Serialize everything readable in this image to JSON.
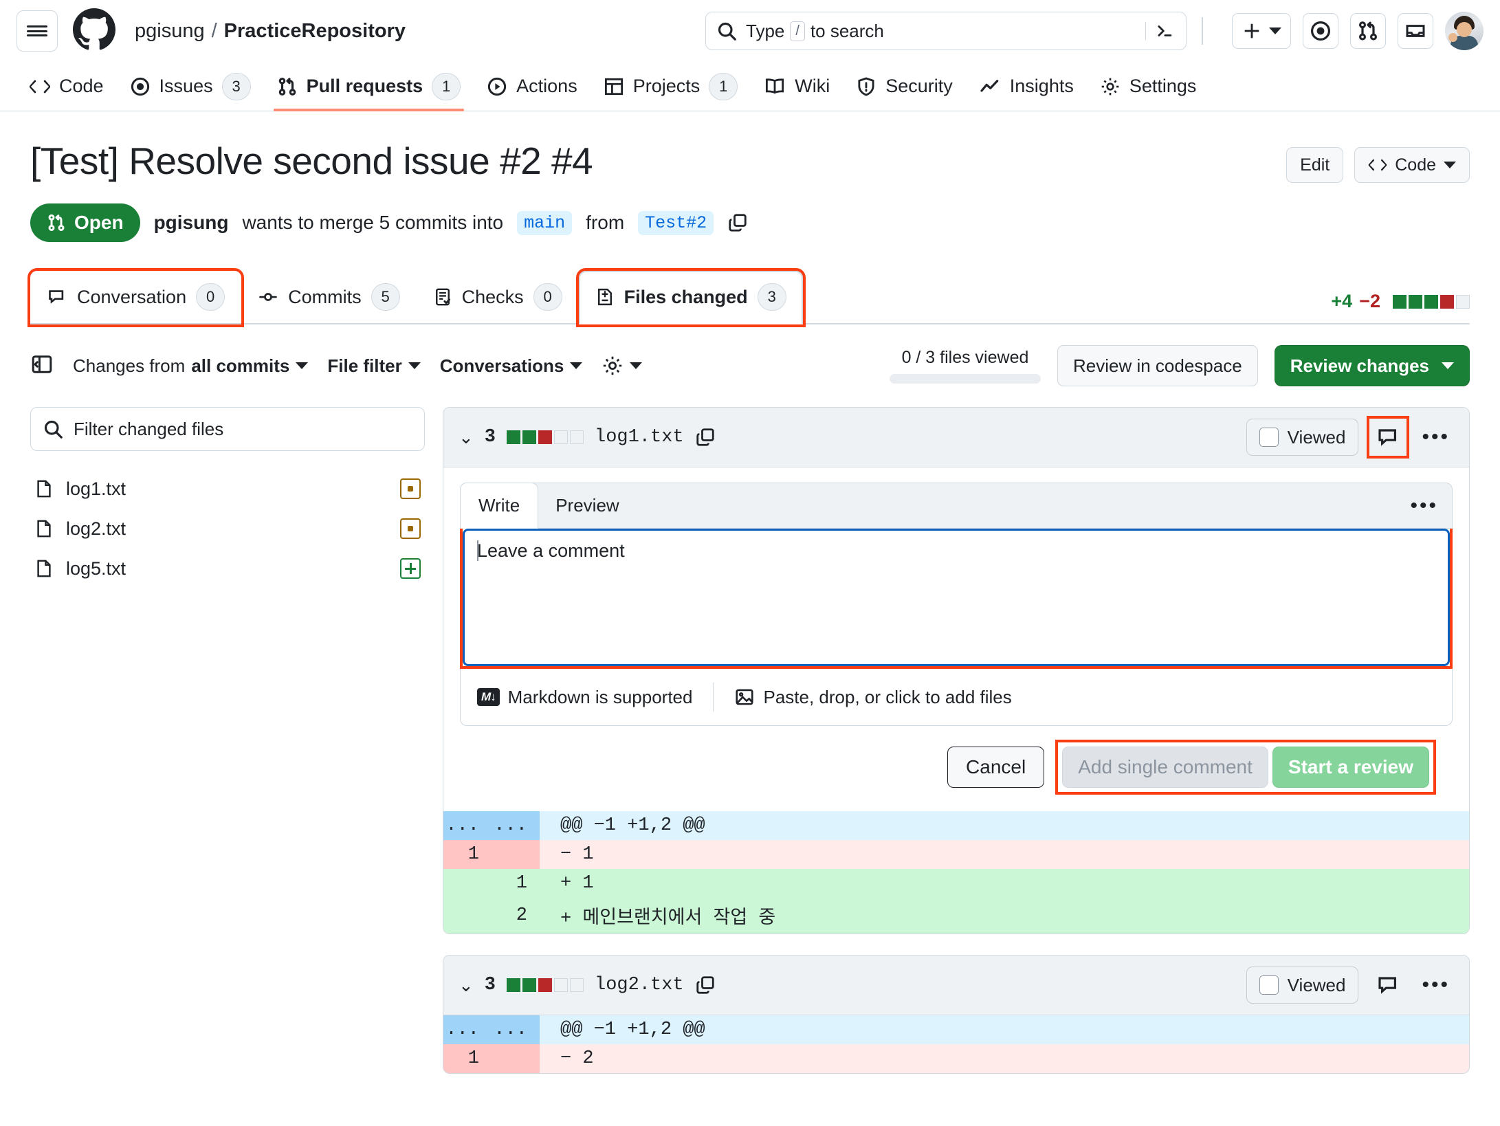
{
  "header": {
    "menu_icon": "hamburger-icon",
    "logo_icon": "github-logo-icon",
    "owner": "pgisung",
    "separator": "/",
    "repo": "PracticeRepository",
    "search": {
      "icon": "search-icon",
      "prefix": "Type",
      "key": "/",
      "suffix": "to search",
      "terminal_icon": "command-palette-icon",
      "placeholder": "Type / to search"
    },
    "actions": [
      {
        "name": "create-new-button",
        "icon": "plus-icon"
      },
      {
        "name": "issues-button",
        "icon": "issue-opened-icon"
      },
      {
        "name": "pull-requests-button",
        "icon": "git-pull-request-icon"
      },
      {
        "name": "notifications-button",
        "icon": "inbox-icon"
      },
      {
        "name": "user-avatar",
        "icon": "avatar"
      }
    ]
  },
  "repo_nav": [
    {
      "label": "Code",
      "icon": "code-icon",
      "count": null,
      "selected": false
    },
    {
      "label": "Issues",
      "icon": "issue-opened-icon",
      "count": "3",
      "selected": false
    },
    {
      "label": "Pull requests",
      "icon": "git-pull-request-icon",
      "count": "1",
      "selected": true
    },
    {
      "label": "Actions",
      "icon": "play-icon",
      "count": null,
      "selected": false
    },
    {
      "label": "Projects",
      "icon": "table-icon",
      "count": "1",
      "selected": false
    },
    {
      "label": "Wiki",
      "icon": "book-icon",
      "count": null,
      "selected": false
    },
    {
      "label": "Security",
      "icon": "shield-icon",
      "count": null,
      "selected": false
    },
    {
      "label": "Insights",
      "icon": "graph-icon",
      "count": null,
      "selected": false
    },
    {
      "label": "Settings",
      "icon": "gear-icon",
      "count": null,
      "selected": false
    }
  ],
  "pr": {
    "title": "[Test] Resolve second issue #2 #4",
    "edit_label": "Edit",
    "code_label": "Code",
    "state": "Open",
    "state_icon": "git-pull-request-icon",
    "author": "pgisung",
    "meta_text_1": "wants to merge 5 commits into",
    "base_branch": "main",
    "meta_text_2": "from",
    "head_branch": "Test#2",
    "copy_icon": "copy-icon",
    "tabs": [
      {
        "label": "Conversation",
        "icon": "comment-icon",
        "count": "0",
        "active": false,
        "highlighted": true
      },
      {
        "label": "Commits",
        "icon": "commit-icon",
        "count": "5",
        "active": false,
        "highlighted": false
      },
      {
        "label": "Checks",
        "icon": "checklist-icon",
        "count": "0",
        "active": false,
        "highlighted": false
      },
      {
        "label": "Files changed",
        "icon": "diff-icon",
        "count": "3",
        "active": true,
        "highlighted": true
      }
    ],
    "diffstat": {
      "additions": "+4",
      "deletions": "−2",
      "squares": [
        "g",
        "g",
        "g",
        "r",
        "e"
      ]
    }
  },
  "toolbar": {
    "collapse_icon": "sidebar-expand-icon",
    "changes_from_prefix": "Changes from",
    "changes_from_value": "all commits",
    "file_filter_label": "File filter",
    "conversations_label": "Conversations",
    "settings_icon": "gear-icon",
    "files_viewed": "0 / 3 files viewed",
    "review_codespace_label": "Review in codespace",
    "review_changes_label": "Review changes"
  },
  "sidebar": {
    "filter": {
      "icon": "search-icon",
      "placeholder": "Filter changed files",
      "value": ""
    },
    "files": [
      {
        "name": "log1.txt",
        "icon": "file-icon",
        "status": "modified",
        "status_icon": "dot-square-icon"
      },
      {
        "name": "log2.txt",
        "icon": "file-icon",
        "status": "modified",
        "status_icon": "dot-square-icon"
      },
      {
        "name": "log5.txt",
        "icon": "file-icon",
        "status": "added",
        "status_icon": "plus-square-icon"
      }
    ]
  },
  "files": [
    {
      "chevron_icon": "chevron-down-icon",
      "changes": "3",
      "squares": [
        "g",
        "g",
        "r",
        "e",
        "e"
      ],
      "name": "log1.txt",
      "copy_icon": "copy-path-icon",
      "viewed_label": "Viewed",
      "comment_icon": "comment-icon",
      "comment_icon_highlighted": true,
      "menu_icon": "kebab-icon",
      "comment_form": {
        "tabs": [
          {
            "label": "Write",
            "active": true
          },
          {
            "label": "Preview",
            "active": false
          }
        ],
        "menu_icon": "kebab-icon",
        "textarea_placeholder": "Leave a comment",
        "textarea_value": "",
        "markdown_icon": "markdown-icon",
        "markdown_label": "Markdown is supported",
        "attach_icon": "image-icon",
        "attach_label": "Paste, drop, or click to add files",
        "cancel_label": "Cancel",
        "add_single_label": "Add single comment",
        "start_review_label": "Start a review"
      },
      "diff": [
        {
          "type": "hunk",
          "old": "...",
          "new": "...",
          "code": "@@ −1 +1,2 @@"
        },
        {
          "type": "del",
          "old": "1",
          "new": "",
          "code": "− 1"
        },
        {
          "type": "add",
          "old": "",
          "new": "1",
          "code": "+ 1"
        },
        {
          "type": "add",
          "old": "",
          "new": "2",
          "code": "+ 메인브랜치에서 작업 중"
        }
      ]
    },
    {
      "chevron_icon": "chevron-down-icon",
      "changes": "3",
      "squares": [
        "g",
        "g",
        "r",
        "e",
        "e"
      ],
      "name": "log2.txt",
      "copy_icon": "copy-path-icon",
      "viewed_label": "Viewed",
      "comment_icon": "comment-icon",
      "comment_icon_highlighted": false,
      "menu_icon": "kebab-icon",
      "diff": [
        {
          "type": "hunk",
          "old": "...",
          "new": "...",
          "code": "@@ −1 +1,2 @@"
        },
        {
          "type": "del",
          "old": "1",
          "new": "",
          "code": "− 2"
        }
      ]
    }
  ],
  "colors": {
    "accent_green": "#1a7f37",
    "highlight_red": "#fa3e14",
    "focus_blue": "#0b5fbd",
    "branch_blue": "#0969da",
    "tab_underline": "#fd8c73"
  }
}
